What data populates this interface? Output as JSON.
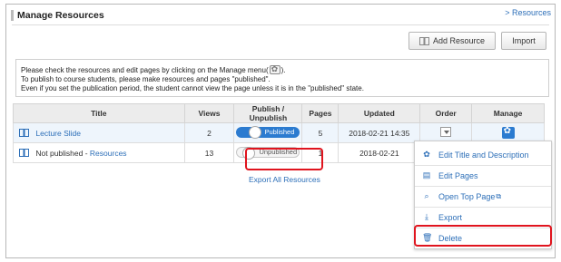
{
  "panel": {
    "title": "Manage Resources",
    "resources_link": "> Resources"
  },
  "toolbar": {
    "add_resource_label": "Add Resource",
    "import_label": "Import"
  },
  "notice": {
    "line1_before": "Please check the resources and edit pages by clicking on the Manage menu(",
    "line1_after": ").",
    "line2": "To publish to course students, please make resources and pages \"published\".",
    "line3": "Even if you set the publication period, the student cannot view the page unless it is in the \"published\" state."
  },
  "table": {
    "headers": [
      "Title",
      "Views",
      "Publish / Unpublish",
      "Pages",
      "Updated",
      "Order",
      "Manage"
    ],
    "rows": [
      {
        "title": "Lecture Slide",
        "title_prefix": "",
        "views": "2",
        "status": "Published",
        "pages": "5",
        "updated": "2018-02-21 14:35"
      },
      {
        "title": "Resources",
        "title_prefix": "Not published - ",
        "views": "13",
        "status": "Unpublished",
        "pages": "1",
        "updated": "2018-02-21"
      }
    ],
    "export_all": "Export All Resources"
  },
  "manage_menu": {
    "items": [
      {
        "label": "Edit Title and Description",
        "icon": "gear-icon"
      },
      {
        "label": "Edit Pages",
        "icon": "pages-icon"
      },
      {
        "label": "Open Top Page",
        "icon": "search-page-icon"
      },
      {
        "label": "Export",
        "icon": "export-icon"
      },
      {
        "label": "Delete",
        "icon": "trash-icon"
      }
    ]
  },
  "colors": {
    "accent": "#2b7bd0",
    "link": "#2d6fb8",
    "highlight": "#e0141e"
  }
}
